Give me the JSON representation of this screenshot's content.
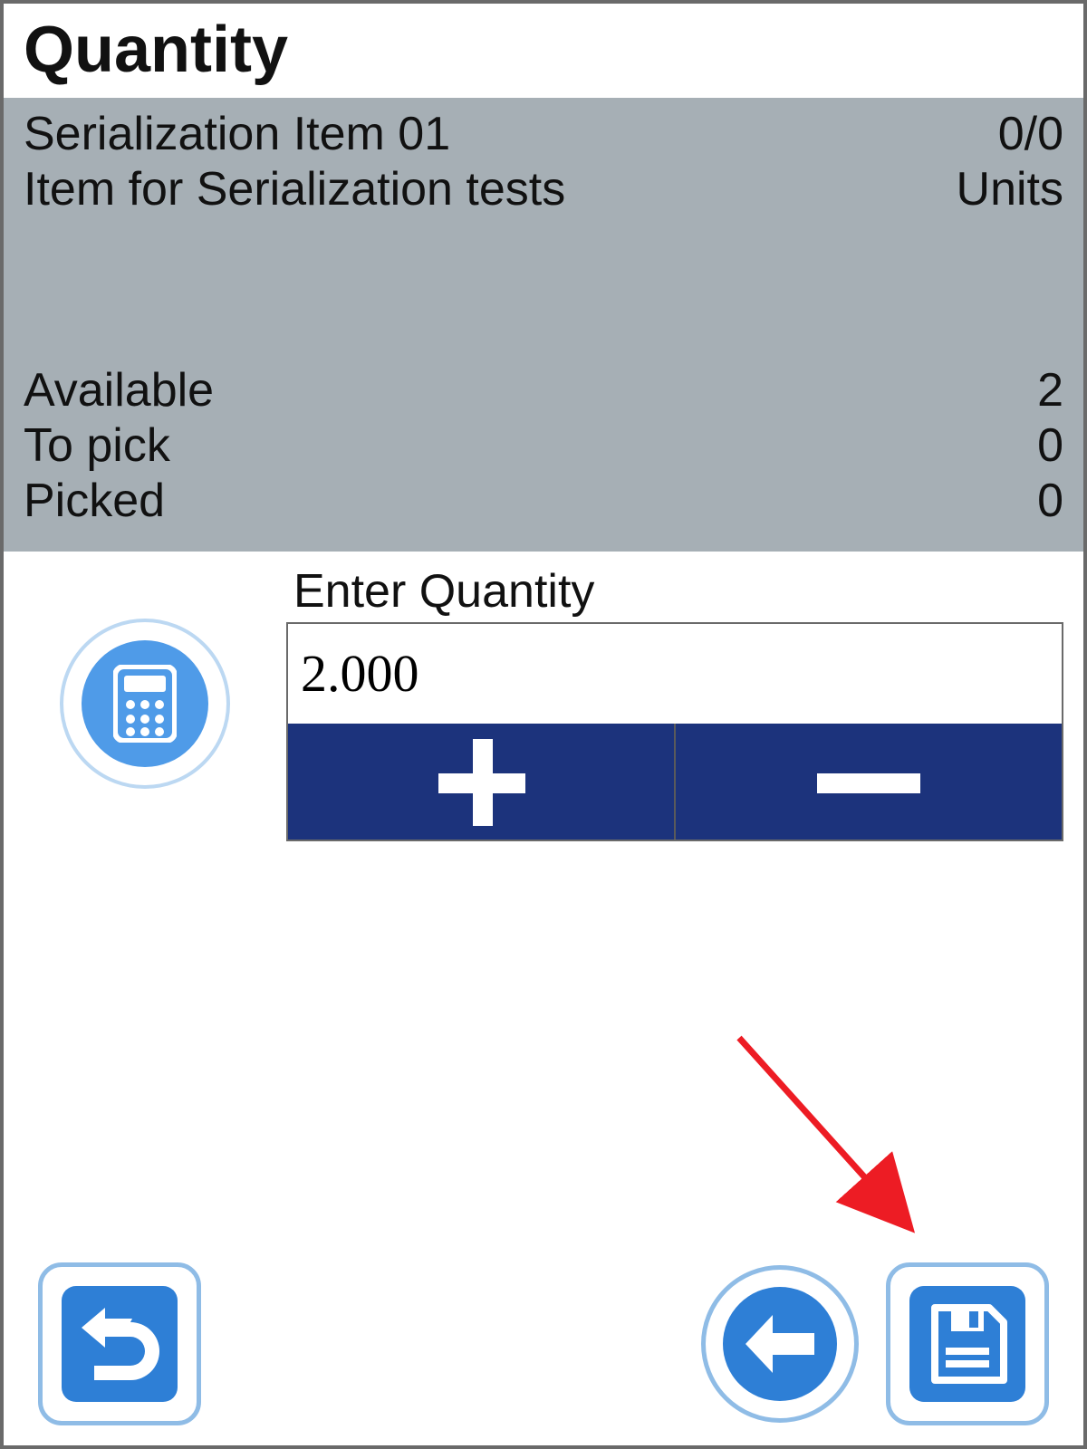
{
  "header": {
    "title": "Quantity"
  },
  "item": {
    "name": "Serialization Item 01",
    "description": "Item for Serialization tests",
    "progress": "0/0",
    "uom": "Units"
  },
  "stats": {
    "available_label": "Available",
    "available_value": "2",
    "to_pick_label": "To pick",
    "to_pick_value": "0",
    "picked_label": "Picked",
    "picked_value": "0"
  },
  "entry": {
    "label": "Enter Quantity",
    "value": "2.000"
  },
  "icons": {
    "calculator": "calculator-icon",
    "undo": "undo-icon",
    "back": "arrow-left-icon",
    "save": "save-floppy-icon",
    "plus": "plus-icon",
    "minus": "minus-icon"
  },
  "colors": {
    "accent_blue": "#2e7fd6",
    "navy": "#1c337c",
    "panel_grey": "#a6afb5",
    "annotation_red": "#ed1c24"
  }
}
